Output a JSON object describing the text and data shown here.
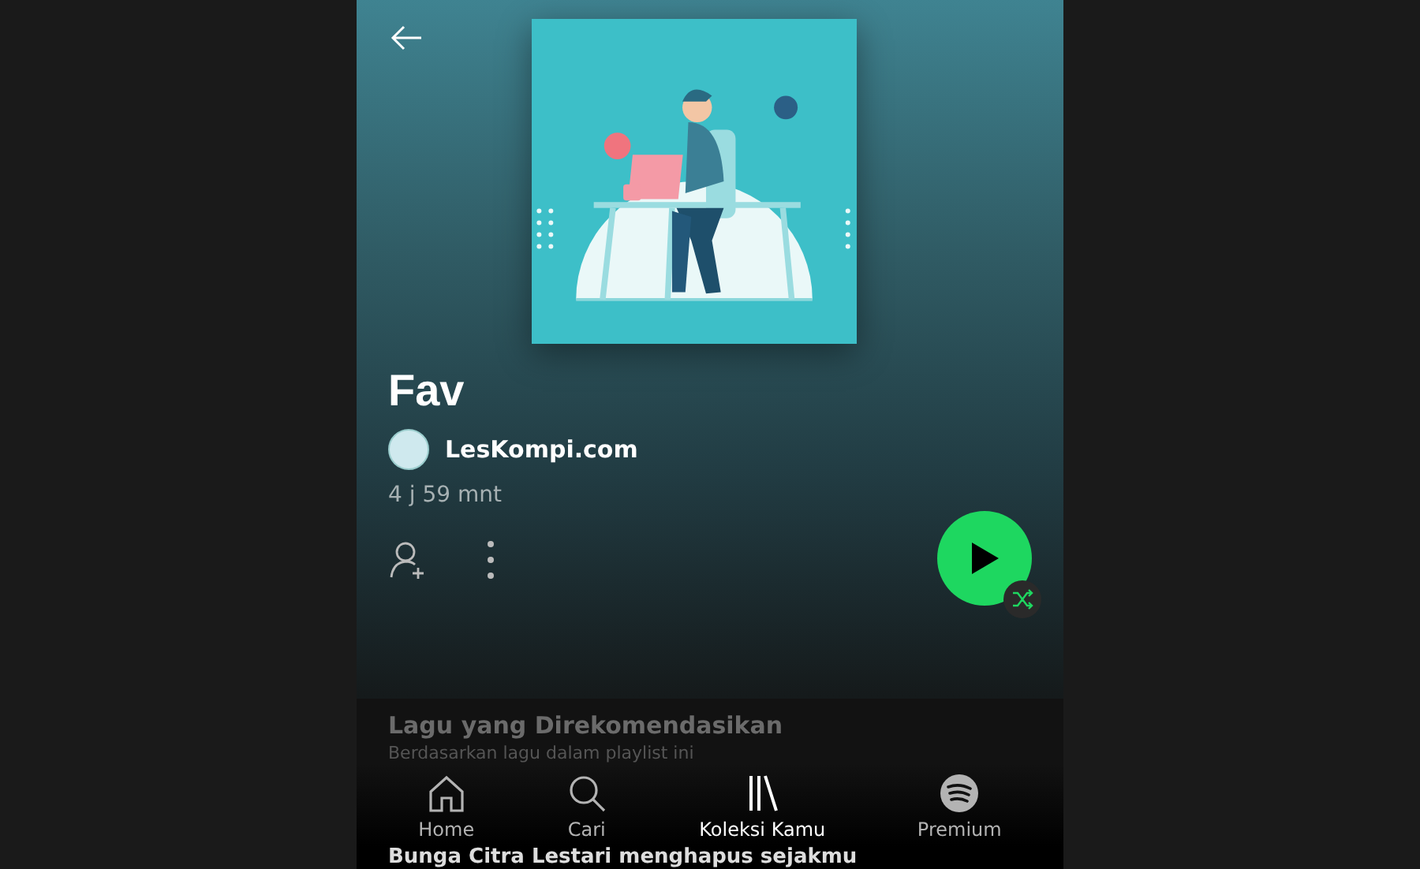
{
  "header": {
    "title": "Fav",
    "owner": "LesKompi.com",
    "duration": "4 j 59 mnt"
  },
  "recommended": {
    "title": "Lagu yang Direkomendasikan",
    "subtitle": "Berdasarkan lagu dalam playlist ini",
    "song": "Bunga Citra Lestari menghapus sejakmu"
  },
  "nav": [
    {
      "label": "Home",
      "kind": "home",
      "selected": false
    },
    {
      "label": "Cari",
      "kind": "search",
      "selected": false
    },
    {
      "label": "Koleksi Kamu",
      "kind": "library",
      "selected": true
    },
    {
      "label": "Premium",
      "kind": "premium",
      "selected": false
    }
  ]
}
